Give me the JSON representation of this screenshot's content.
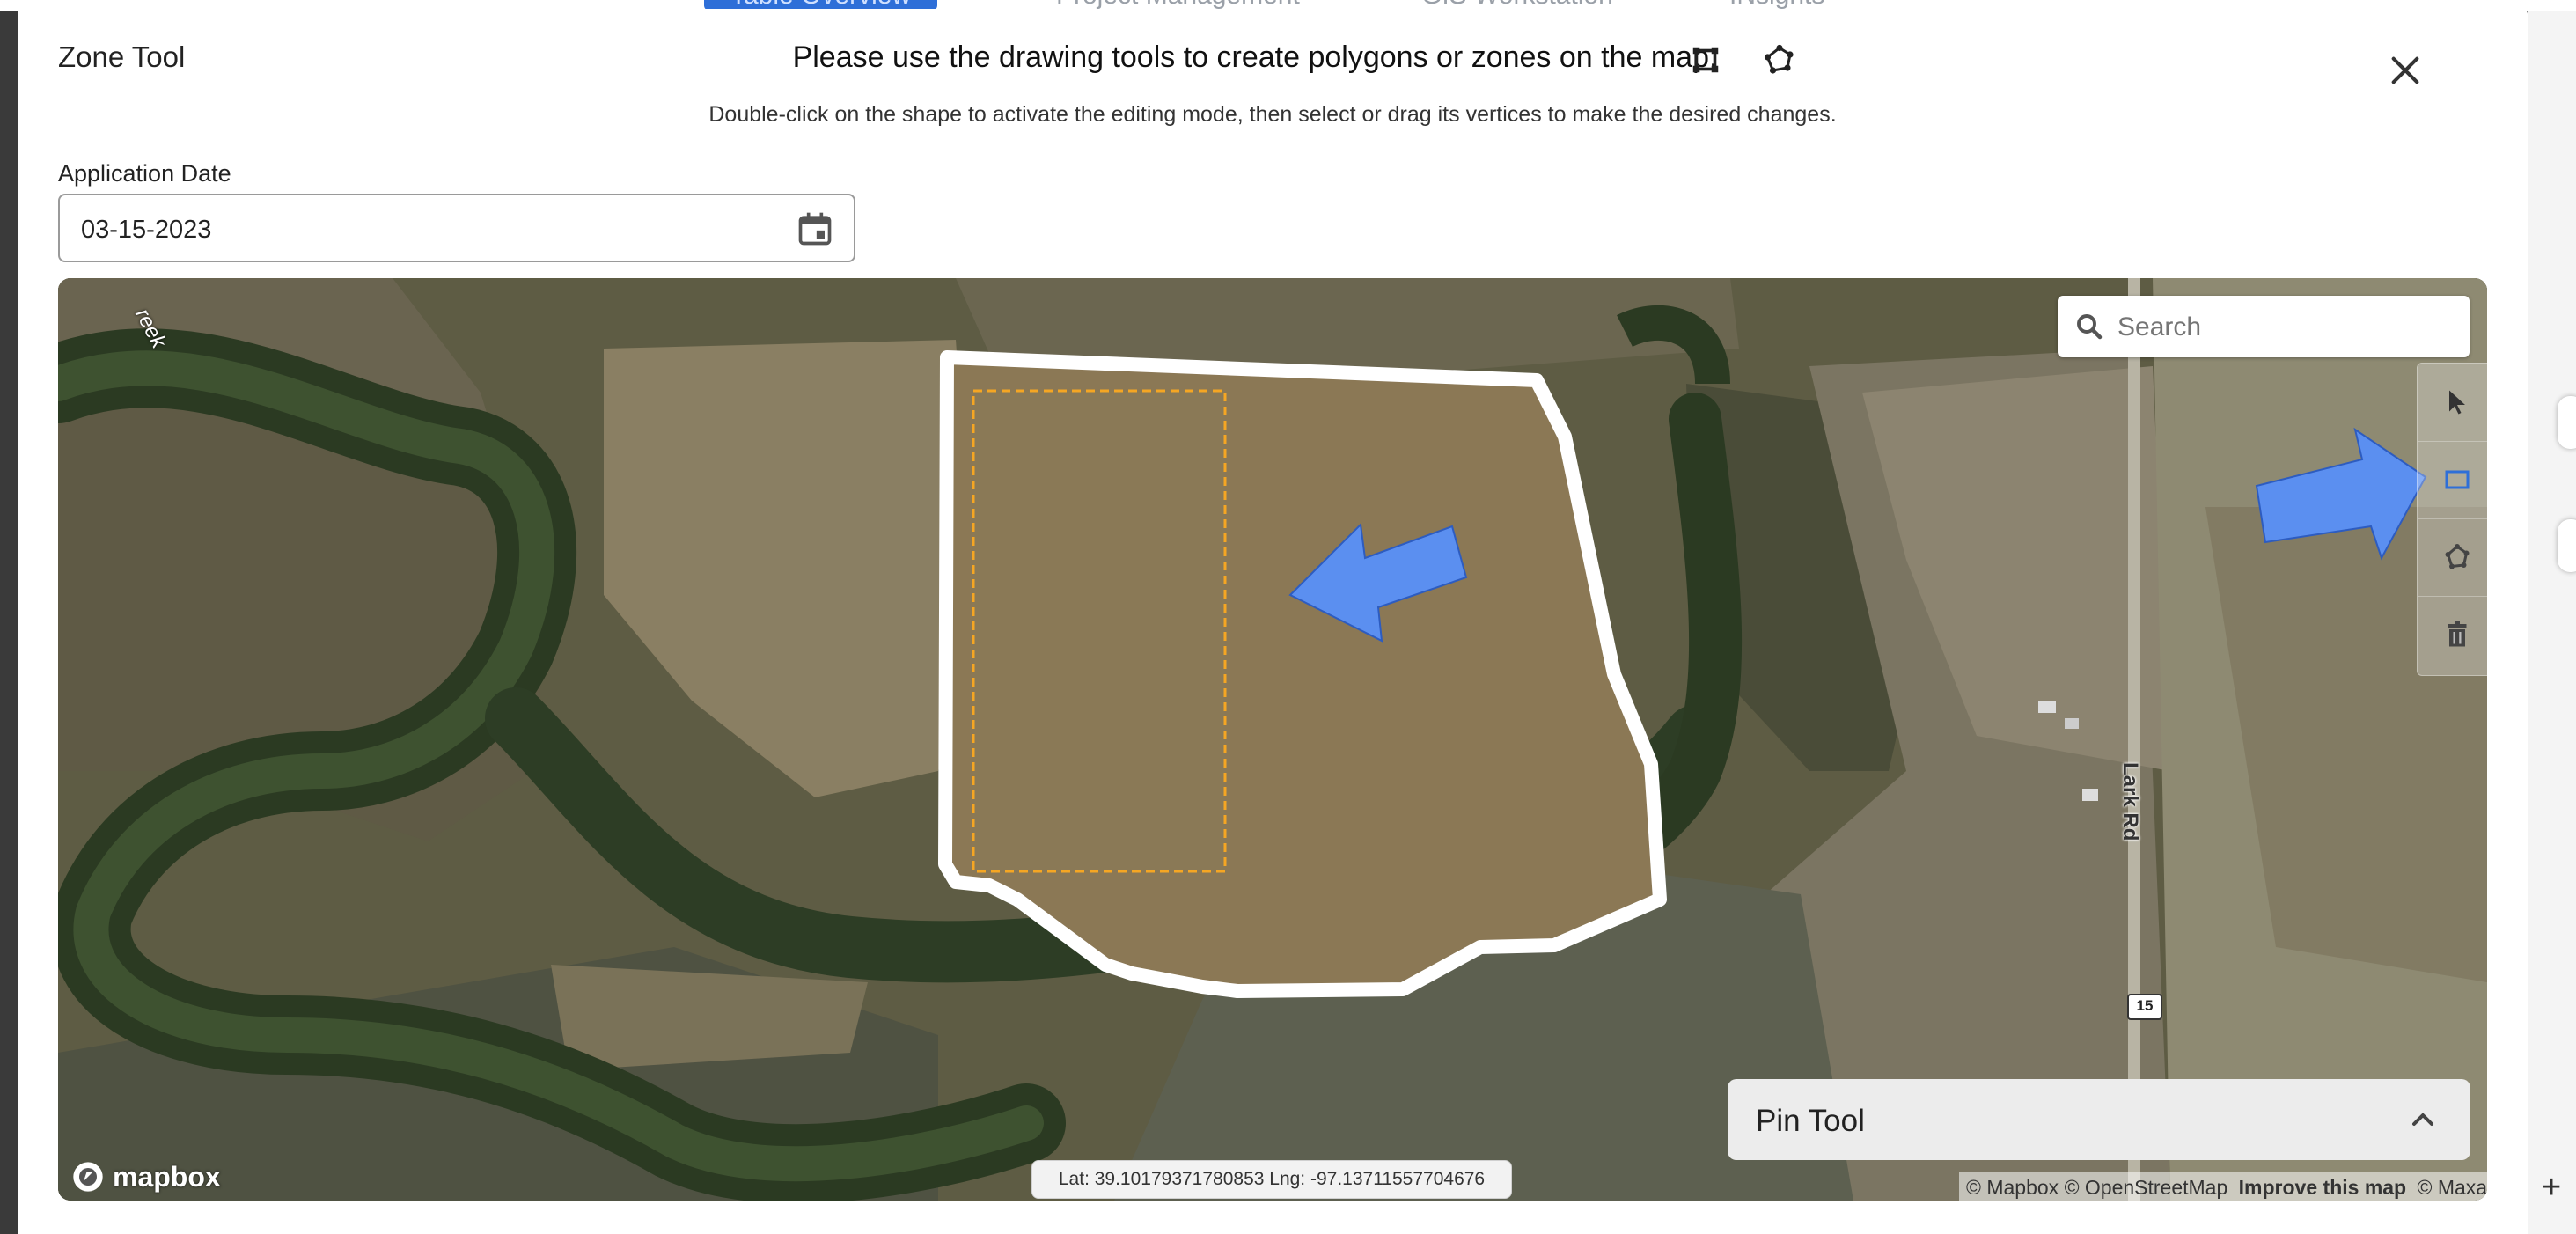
{
  "background_app": {
    "tabs": [
      "Table Overview",
      "Project Management",
      "GIS Workstation",
      "INsights"
    ]
  },
  "modal": {
    "title": "Zone Tool",
    "instruction": "Please use the drawing tools to create polygons or zones on the map.",
    "subtitle": "Double-click on the shape to activate the editing mode, then select or drag its vertices to make the desired changes.",
    "header_icons": [
      "draw-rectangle-icon",
      "draw-polygon-icon"
    ],
    "close_icon": "close-icon"
  },
  "application_date": {
    "label": "Application Date",
    "value": "03-15-2023",
    "icon": "calendar-icon"
  },
  "map": {
    "search": {
      "placeholder": "Search",
      "icon": "search-icon"
    },
    "draw_tools": [
      "select-pointer-icon",
      "draw-rectangle-icon",
      "draw-polygon-icon",
      "trash-icon"
    ],
    "active_tool": "draw-rectangle-icon",
    "pin_tool": {
      "label": "Pin Tool",
      "icon": "chevron-up-icon"
    },
    "coordinates": "Lat: 39.10179371780853 Lng: -97.13711557704676",
    "attribution": {
      "mapbox": "© Mapbox",
      "osm": "© OpenStreetMap",
      "improve": "Improve this map",
      "maxar": "© Maxar"
    },
    "logo": "mapbox",
    "road_label": "Lark Rd",
    "route_badge": "15",
    "creek_label": "reek",
    "colors": {
      "field_outline": "#ffffff",
      "rectangle_dash": "#f5a623",
      "arrow": "#5b8ff0"
    }
  }
}
